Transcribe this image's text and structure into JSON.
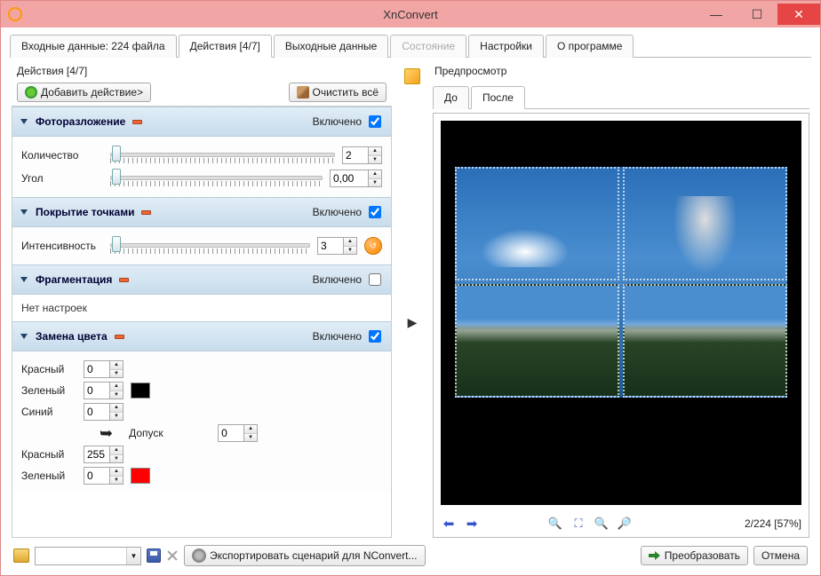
{
  "window_title": "XnConvert",
  "main_tabs": [
    {
      "label": "Входные данные: 224 файла",
      "active": false,
      "disabled": false
    },
    {
      "label": "Действия [4/7]",
      "active": true,
      "disabled": false
    },
    {
      "label": "Выходные данные",
      "active": false,
      "disabled": false
    },
    {
      "label": "Состояние",
      "active": false,
      "disabled": true
    },
    {
      "label": "Настройки",
      "active": false,
      "disabled": false
    },
    {
      "label": "О программе",
      "active": false,
      "disabled": false
    }
  ],
  "left": {
    "header": "Действия [4/7]",
    "add_button": "Добавить действие>",
    "clear_button": "Очистить всё",
    "enabled_label": "Включено",
    "groups": [
      {
        "title": "Фоторазложение",
        "enabled": true,
        "rows": [
          {
            "label": "Количество",
            "value": "2",
            "has_slider": true
          },
          {
            "label": "Угол",
            "value": "0,00",
            "has_slider": true
          }
        ]
      },
      {
        "title": "Покрытие точками",
        "enabled": true,
        "rows": [
          {
            "label": "Интенсивность",
            "value": "3",
            "has_slider": true,
            "has_round_btn": true
          }
        ]
      },
      {
        "title": "Фрагментация",
        "enabled": false,
        "no_opts": "Нет настроек"
      },
      {
        "title": "Замена цвета",
        "enabled": true,
        "color_rows1": [
          {
            "label": "Красный",
            "value": "0"
          },
          {
            "label": "Зеленый",
            "value": "0",
            "swatch": "#000000"
          },
          {
            "label": "Синий",
            "value": "0"
          }
        ],
        "tolerance_label": "Допуск",
        "tolerance_value": "0",
        "color_rows2": [
          {
            "label": "Красный",
            "value": "255"
          },
          {
            "label": "Зеленый",
            "value": "0",
            "swatch": "#ff0000"
          }
        ]
      }
    ]
  },
  "right": {
    "preview_label": "Предпросмотр",
    "preview_tabs": [
      {
        "label": "До",
        "active": false
      },
      {
        "label": "После",
        "active": true
      }
    ],
    "status": "2/224 [57%]"
  },
  "bottom": {
    "export_label": "Экспортировать сценарий для NConvert...",
    "convert_label": "Преобразовать",
    "cancel_label": "Отмена"
  }
}
